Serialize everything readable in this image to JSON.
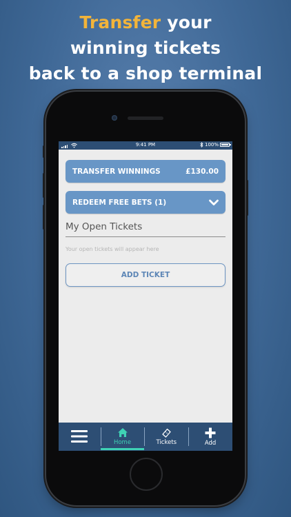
{
  "headline": {
    "accent": "Transfer",
    "line1_rest": " your",
    "line2": "winning tickets",
    "line3": "back to a shop terminal"
  },
  "status_bar": {
    "time": "9:41 PM",
    "battery": "100%"
  },
  "main": {
    "transfer_label": "TRANSFER WINNINGS",
    "transfer_amount": "£130.00",
    "redeem_label": "REDEEM FREE BETS (1)",
    "section_title": "My Open Tickets",
    "empty_text": "Your open tickets will appear here",
    "add_ticket_label": "ADD TICKET"
  },
  "tabs": {
    "home": "Home",
    "tickets": "Tickets",
    "add": "Add"
  },
  "colors": {
    "accent": "#f2b43a",
    "primary_button": "#6896c6",
    "nav_bar": "#2d4e74",
    "active_tab": "#3fd1b4"
  }
}
